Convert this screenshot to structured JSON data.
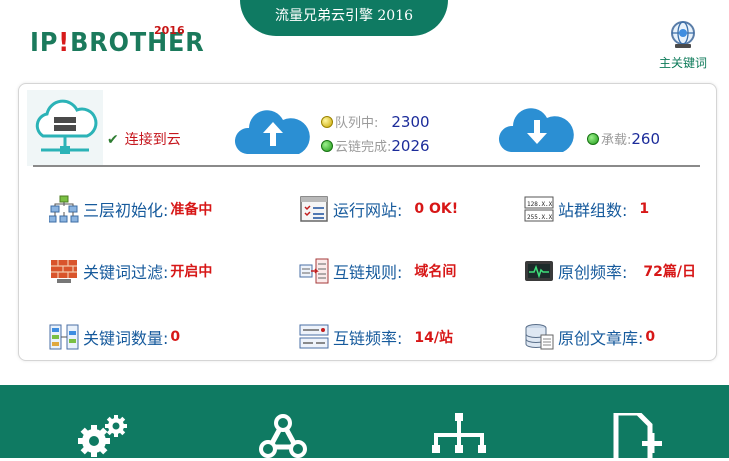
{
  "header": {
    "title": "流量兄弟云引擎 2016",
    "logo_text": "IP!BROTHER",
    "logo_year": "2016",
    "main_keyword_label": "主关键词"
  },
  "status": {
    "connected_label": "连接到云",
    "queue_label": "队列中:",
    "queue_value": "2300",
    "done_label": "云链完成:",
    "done_value": "2026",
    "load_label": "承载:",
    "load_value": "260"
  },
  "grid": [
    {
      "label": "三层初始化:",
      "value": "准备中",
      "icon": "hierarchy-icon"
    },
    {
      "label": "运行网站:",
      "value": "0 OK!",
      "icon": "checklist-icon"
    },
    {
      "label": "站群组数:",
      "value": "1",
      "icon": "ip-table-icon"
    },
    {
      "label": "关键词过滤:",
      "value": "开启中",
      "icon": "firewall-icon"
    },
    {
      "label": "互链规则:",
      "value": "域名间",
      "icon": "link-rule-icon"
    },
    {
      "label": "原创频率:",
      "value": "72篇/日",
      "icon": "monitor-icon"
    },
    {
      "label": "关键词数量:",
      "value": "0",
      "icon": "keyword-list-icon"
    },
    {
      "label": "互链频率:",
      "value": "14/站",
      "icon": "link-freq-icon"
    },
    {
      "label": "原创文章库:",
      "value": "0",
      "icon": "database-icon"
    }
  ],
  "bottom_nav": [
    "settings-gears-icon",
    "webhook-icon",
    "sitemap-icon",
    "add-page-icon"
  ],
  "colors": {
    "brand": "#0f7a62",
    "accent_red": "#d71717",
    "label_blue": "#165a9c",
    "cloud_blue": "#2b8fd3"
  }
}
